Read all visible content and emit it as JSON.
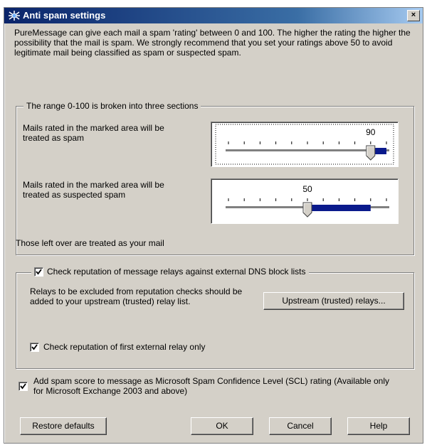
{
  "window": {
    "title": "Anti spam settings",
    "close_label": "×"
  },
  "intro": "PureMessage can give each mail a spam 'rating' between 0 and 100. The higher the rating the higher the possibility that the mail is spam. We strongly recommend that you set your ratings above 50 to avoid legitimate mail being classified as spam or suspected spam.",
  "range_group": {
    "legend": "The range 0-100 is broken into three sections",
    "spam": {
      "label": "Mails rated in the marked area will be treated as spam",
      "value": 90
    },
    "suspected": {
      "label": "Mails rated in the marked area will be treated as suspected spam",
      "value": 50
    },
    "remaining": "Those left over are treated as your mail",
    "range": [
      0,
      100
    ]
  },
  "dns": {
    "checkbox_label": "Check reputation of message relays against external DNS block lists",
    "checked": true,
    "relay_text": "Relays to be excluded from reputation checks should be added to your upstream (trusted) relay list.",
    "upstream_button": "Upstream (trusted) relays...",
    "first_relay_label": "Check reputation of first external relay only",
    "first_relay_checked": true
  },
  "scl": {
    "label": "Add spam score to message as Microsoft Spam Confidence Level (SCL) rating (Available only for Microsoft Exchange 2003 and above)",
    "checked": true
  },
  "buttons": {
    "restore": "Restore defaults",
    "ok": "OK",
    "cancel": "Cancel",
    "help": "Help"
  },
  "colors": {
    "titlebar": "#0a246a",
    "slider_fill": "#0a1a8c",
    "face": "#d4d0c8"
  }
}
